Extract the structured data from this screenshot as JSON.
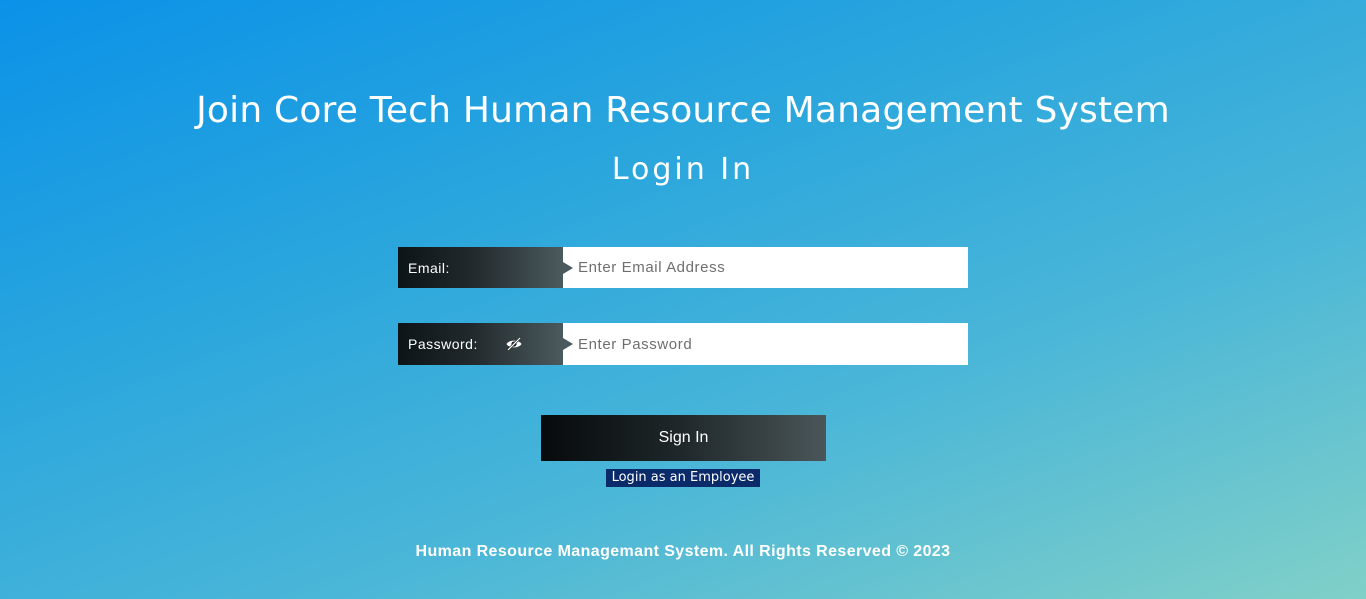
{
  "header": {
    "title": "Join Core Tech Human Resource Management System",
    "subtitle": "Login In"
  },
  "form": {
    "email": {
      "label": "Email:",
      "placeholder": "Enter Email Address",
      "value": ""
    },
    "password": {
      "label": "Password:",
      "placeholder": "Enter Password",
      "value": "",
      "toggle_icon": "eye-slash-icon"
    },
    "submit_label": "Sign In",
    "employee_link_label": "Login as an Employee"
  },
  "footer": {
    "text": "Human Resource Managemant System. All Rights Reserved © 2023"
  },
  "colors": {
    "background_start": "#0b92e8",
    "background_end": "#80d0c8",
    "label_dark": "#0d1417",
    "link_highlight": "#0b2a6a"
  }
}
